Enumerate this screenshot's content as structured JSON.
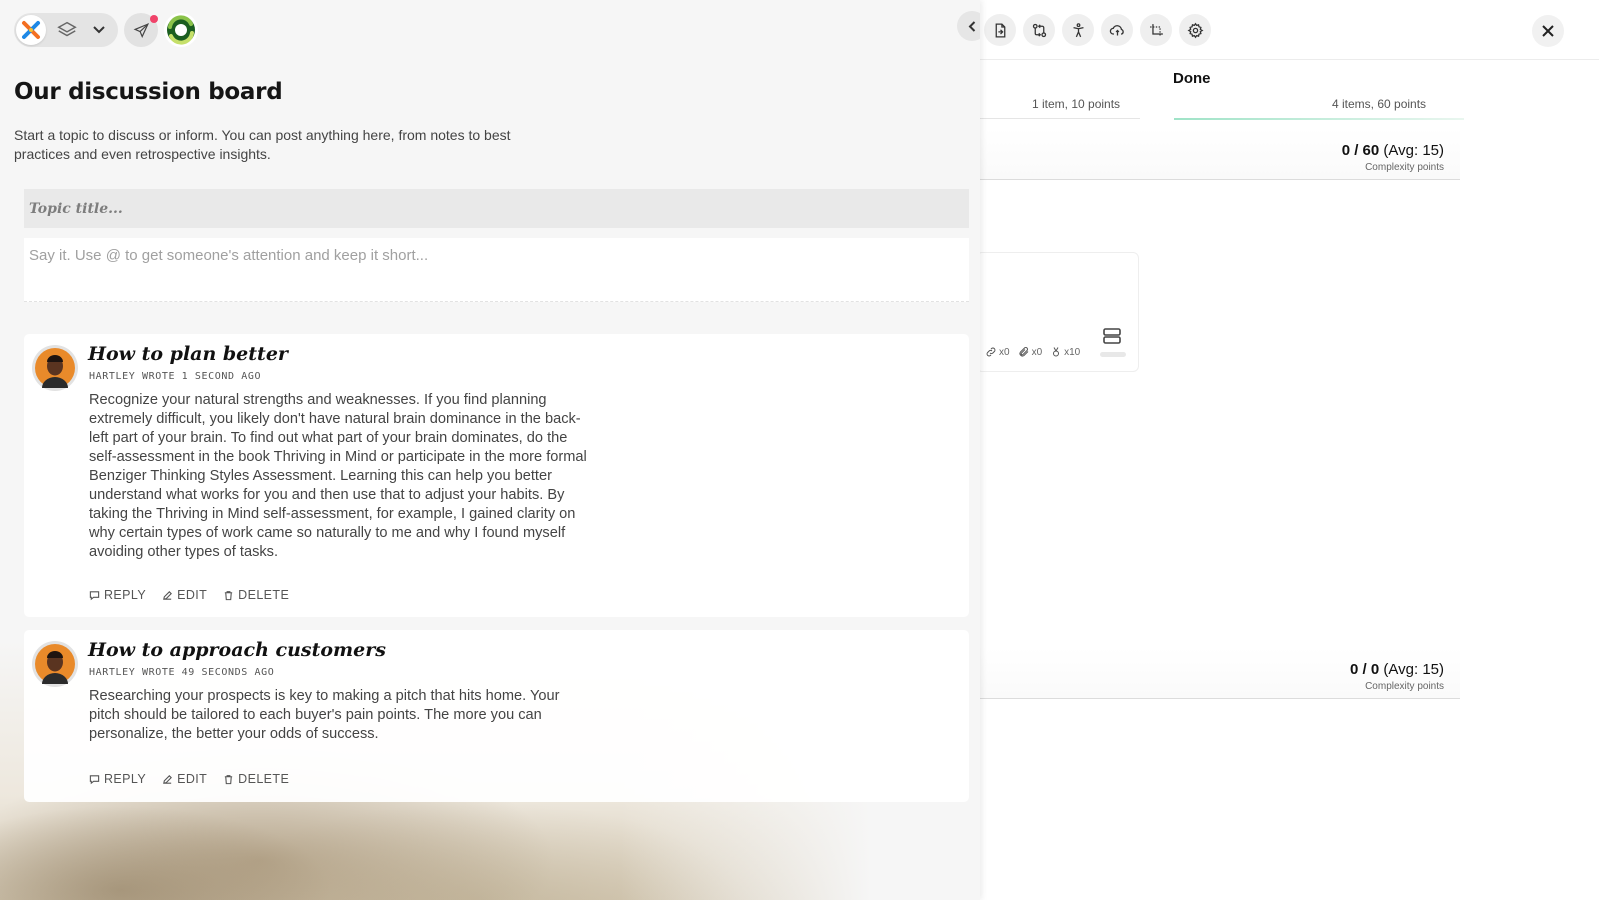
{
  "board": {
    "toolbar_icons": [
      "file-export-icon",
      "git-compare-icon",
      "accessibility-icon",
      "cloud-sync-icon",
      "crop-icon",
      "gear-icon"
    ],
    "close_icon": "close-icon",
    "column_title": "Done",
    "left_count": "1 item, 10 points",
    "right_count": "4 items, 60 points",
    "summary_top": {
      "points": "0 / 60",
      "avg": "(Avg: 15)",
      "label": "Complexity points"
    },
    "summary_bottom": {
      "points": "0 / 0",
      "avg": "(Avg: 15)",
      "label": "Complexity points"
    },
    "card": {
      "links": "x0",
      "attachments": "x0",
      "award": "x10"
    }
  },
  "panel": {
    "title": "Our discussion board",
    "intro": "Start a topic to discuss or inform. You can post anything here, from notes to best practices and even retrospective insights.",
    "topic_placeholder": "Topic title...",
    "body_placeholder": "Say it. Use @ to get someone's attention and keep it short...",
    "posts": [
      {
        "title": "How to plan better",
        "meta": "Hartley wrote 1 second ago",
        "body": "Recognize your natural strengths and weaknesses. If you find planning extremely difficult, you likely don't have natural brain dominance in the back-left part of your brain. To find out what part of your brain dominates, do the self-assessment in the book Thriving in Mind or participate in the more formal Benziger Thinking Styles Assessment. Learning this can help you better understand what works for you and then use that to adjust your habits. By taking the Thriving in Mind self-assessment, for example, I gained clarity on why certain types of work came so naturally to me and why I found myself avoiding other types of tasks.",
        "reply": "REPLY",
        "edit": "EDIT",
        "delete": "DELETE"
      },
      {
        "title": "How to approach customers",
        "meta": "Hartley wrote 49 seconds ago",
        "body": "Researching your prospects is key to making a pitch that hits home. Your pitch should be tailored to each buyer's pain points. The more you can personalize, the better your odds of success.",
        "reply": "REPLY",
        "edit": "EDIT",
        "delete": "DELETE"
      }
    ]
  },
  "colors": {
    "accent_green": "#9fe3c7",
    "notification": "#f0436a",
    "panel_bg": "#f6f6f6"
  }
}
